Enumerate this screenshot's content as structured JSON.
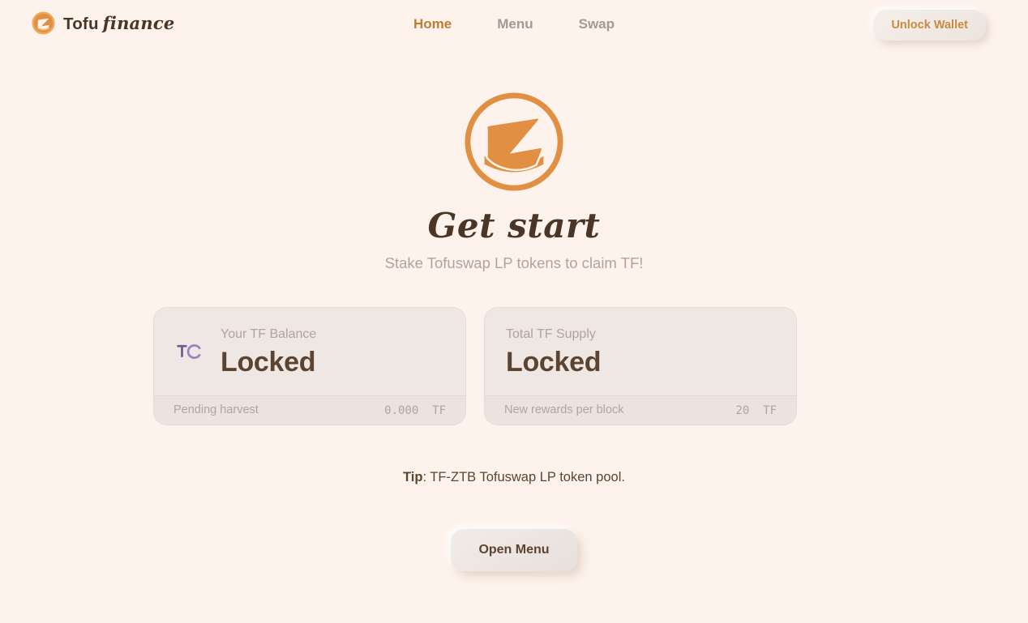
{
  "theme": {
    "page_bg": "#fdf3ec",
    "accent": "#c07d33",
    "text_dark": "#5c4430",
    "text_muted": "#b0a49c",
    "card_bg": "#efe7e4",
    "logo_orange": "#e18f42",
    "icon_purple": "#8b6fae"
  },
  "header": {
    "brand": {
      "icon": "tofu-coin-logo-icon",
      "name_primary": "Tofu",
      "name_secondary": "finance"
    },
    "nav": [
      {
        "label": "Home",
        "active": true
      },
      {
        "label": "Menu",
        "active": false
      },
      {
        "label": "Swap",
        "active": false
      }
    ],
    "unlock_wallet_label": "Unlock Wallet"
  },
  "hero": {
    "logo_icon": "tofu-z-emblem-icon",
    "title": "Get start",
    "subtitle": "Stake Tofuswap LP tokens to claim TF!"
  },
  "cards": [
    {
      "icon": "loading-spinner-icon",
      "label": "Your TF Balance",
      "value": "Locked",
      "footer_label": "Pending harvest",
      "footer_value": "0.000  TF"
    },
    {
      "icon": null,
      "label": "Total TF Supply",
      "value": "Locked",
      "footer_label": "New rewards per block",
      "footer_value": "20  TF"
    }
  ],
  "tip": {
    "prefix": "Tip",
    "text": ": TF-ZTB Tofuswap LP token pool."
  },
  "open_menu_label": "Open Menu"
}
